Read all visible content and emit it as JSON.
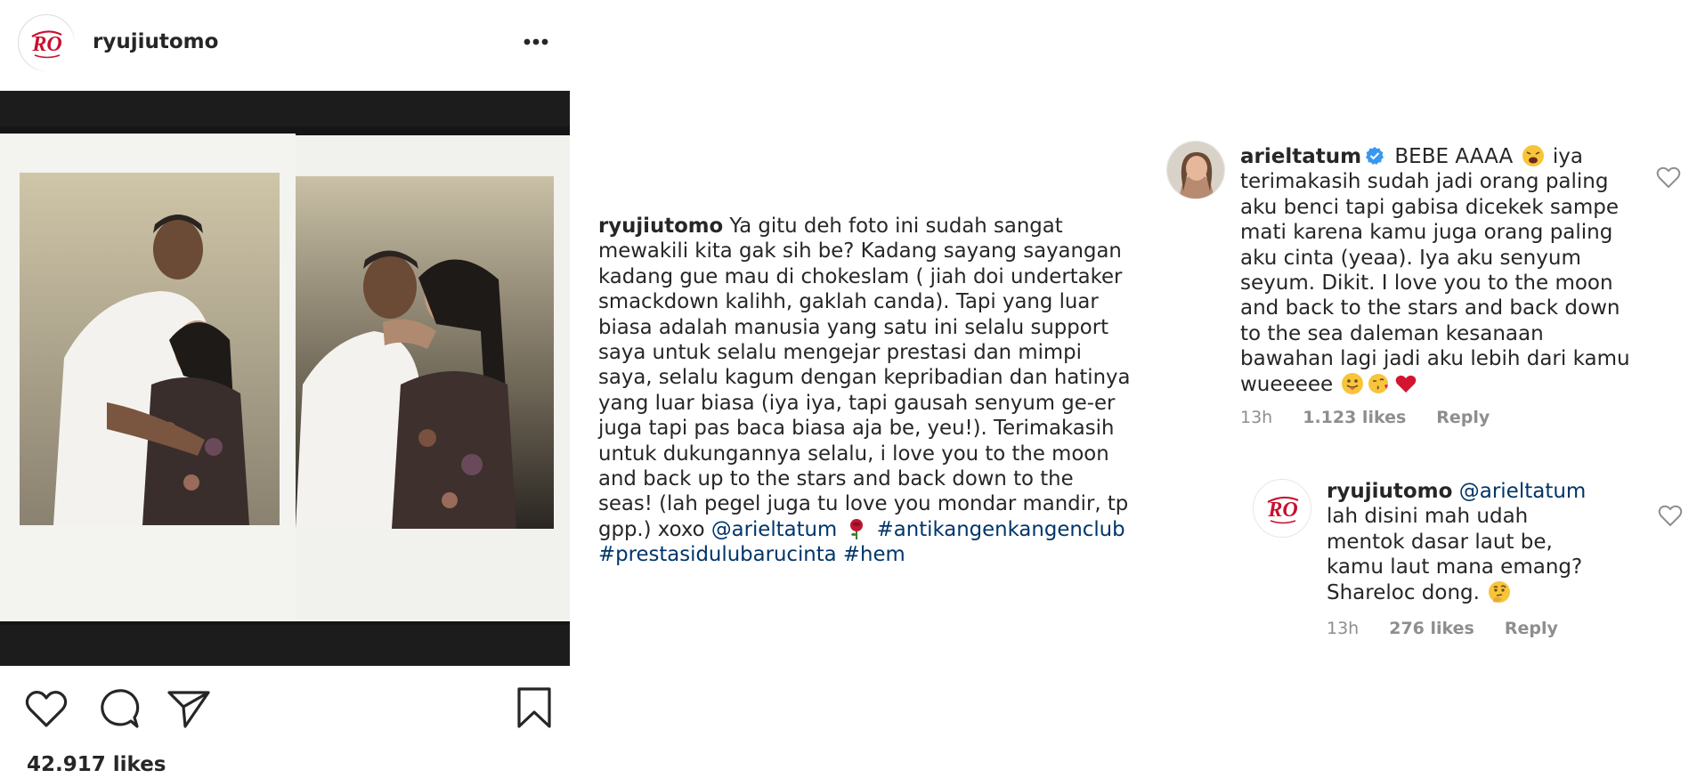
{
  "post": {
    "username": "ryujiutomo",
    "logo_text": "RO",
    "likes": "42.917 likes",
    "icons": {
      "more": "more-options-icon",
      "like": "heart-icon",
      "comment": "comment-icon",
      "share": "paper-plane-icon",
      "save": "bookmark-icon"
    }
  },
  "caption": {
    "username": "ryujiutomo",
    "text": " Ya gitu deh foto ini sudah sangat mewakili kita gak sih be? Kadang sayang sayangan kadang gue mau di chokeslam ( jiah doi undertaker smackdown kalihh, gaklah canda). Tapi yang luar biasa adalah manusia yang satu ini selalu support saya untuk selalu mengejar prestasi dan mimpi saya, selalu kagum dengan kepribadian dan hatinya yang luar biasa (iya iya, tapi gausah senyum ge-er juga tapi pas baca biasa aja be, yeu!). Terimakasih untuk dukungannya selalu, i love you to the moon and back up to the stars and back down to the seas! (lah pegel juga tu love you mondar mandir, tp gpp.) xoxo ",
    "mention": "@arieltatum",
    "rose_emoji": "rose-emoji",
    "hashtag1": "#antikangenkangenclub",
    "hashtag2": "#prestasidulubarucinta",
    "hashtag3": "#hem"
  },
  "comments": [
    {
      "username": "arieltatum",
      "verified": true,
      "text_before_emoji": " BEBE AAAA ",
      "text_after_emoji": " iya terimakasih sudah jadi orang paling aku benci tapi gabisa dicekek sampe mati karena kamu juga orang paling aku cinta (yeaa). Iya aku senyum seyum. Dikit. I love you to the moon and back to the stars and back down to the sea daleman kesanaan bawahan lagi jadi aku lebih dari kamu wueeeee ",
      "time": "13h",
      "likes": "1.123 likes",
      "reply": "Reply"
    },
    {
      "username": "ryujiutomo",
      "mention": "@arieltatum",
      "text": " lah disini mah udah mentok dasar laut be, kamu laut mana emang? Shareloc dong. ",
      "time": "13h",
      "likes": "276 likes",
      "reply": "Reply"
    }
  ],
  "colors": {
    "brand_red": "#c8102e",
    "link_blue": "#003569",
    "meta_grey": "#8e8e8e",
    "verified_blue": "#3897f0",
    "heart_red": "#e0245e"
  }
}
